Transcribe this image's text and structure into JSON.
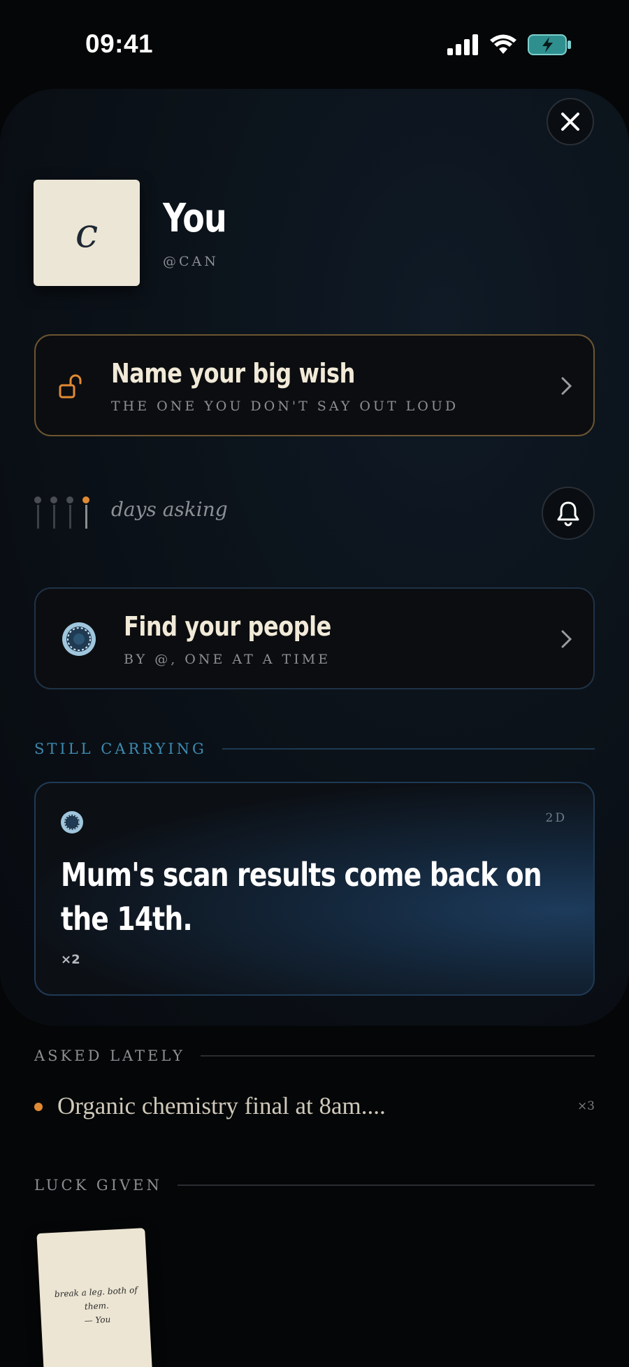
{
  "status_bar": {
    "time": "09:41"
  },
  "profile": {
    "avatar_letter": "c",
    "name": "You",
    "handle": "@CAN"
  },
  "wish_card": {
    "title": "Name your big wish",
    "subtitle": "THE ONE YOU DON'T SAY OUT LOUD"
  },
  "days": {
    "label": "days asking",
    "ticks_total": 4,
    "ticks_active": 1
  },
  "people_card": {
    "title": "Find your people",
    "subtitle": "BY @, ONE AT A TIME"
  },
  "still_carrying": {
    "header": "STILL CARRYING",
    "item": {
      "text": "Mum's scan results come back on the 14th.",
      "age": "2D",
      "count": "×2"
    }
  },
  "asked_lately": {
    "header": "ASKED LATELY",
    "items": [
      {
        "text": "Organic chemistry final at 8am....",
        "count": "×3"
      }
    ]
  },
  "luck_given": {
    "header": "LUCK GIVEN",
    "notes": [
      {
        "text": "break a leg. both of them.",
        "signature": "— You"
      }
    ]
  },
  "colors": {
    "accent_orange": "#e08a34",
    "accent_blue": "#3d8bb0",
    "wish_border": "#6b5531",
    "people_border": "#1f3246"
  }
}
